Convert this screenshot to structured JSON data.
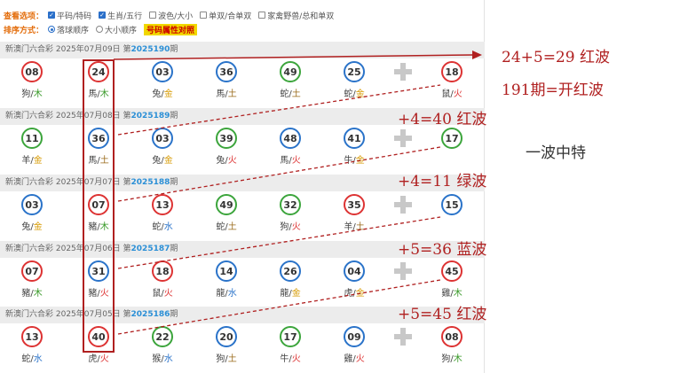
{
  "options": {
    "view_title": "查看选项：",
    "view_items": [
      {
        "label": "平码/特码",
        "checked": true
      },
      {
        "label": "生肖/五行",
        "checked": true
      },
      {
        "label": "波色/大小",
        "checked": false
      },
      {
        "label": "单双/合单双",
        "checked": false
      },
      {
        "label": "家禽野兽/总和单双",
        "checked": false
      }
    ],
    "sort_title": "排序方式：",
    "sort_items": [
      {
        "label": "落球顺序",
        "selected": true
      },
      {
        "label": "大小顺序",
        "selected": false
      }
    ],
    "highlight_label": "号码属性对照"
  },
  "draws": [
    {
      "header": "新澳门六合彩 2025年07月09日 第",
      "issue": "2025190",
      "suffix": "期",
      "balls": [
        {
          "num": "08",
          "color": "red",
          "zodiac": "狗",
          "element": "木",
          "el_class": "el-wood"
        },
        {
          "num": "24",
          "color": "red",
          "zodiac": "馬",
          "element": "木",
          "el_class": "el-wood"
        },
        {
          "num": "03",
          "color": "blue",
          "zodiac": "兔",
          "element": "金",
          "el_class": "el-gold"
        },
        {
          "num": "36",
          "color": "blue",
          "zodiac": "馬",
          "element": "土",
          "el_class": "el-earth"
        },
        {
          "num": "49",
          "color": "green",
          "zodiac": "蛇",
          "element": "土",
          "el_class": "el-earth"
        },
        {
          "num": "25",
          "color": "blue",
          "zodiac": "蛇",
          "element": "金",
          "el_class": "el-gold"
        },
        {
          "num": "18",
          "color": "red",
          "zodiac": "鼠",
          "element": "火",
          "el_class": "el-fire"
        }
      ]
    },
    {
      "header": "新澳门六合彩 2025年07月08日 第",
      "issue": "2025189",
      "suffix": "期",
      "balls": [
        {
          "num": "11",
          "color": "green",
          "zodiac": "羊",
          "element": "金",
          "el_class": "el-gold"
        },
        {
          "num": "36",
          "color": "blue",
          "zodiac": "馬",
          "element": "土",
          "el_class": "el-earth"
        },
        {
          "num": "03",
          "color": "blue",
          "zodiac": "兔",
          "element": "金",
          "el_class": "el-gold"
        },
        {
          "num": "39",
          "color": "green",
          "zodiac": "兔",
          "element": "火",
          "el_class": "el-fire"
        },
        {
          "num": "48",
          "color": "blue",
          "zodiac": "馬",
          "element": "火",
          "el_class": "el-fire"
        },
        {
          "num": "41",
          "color": "blue",
          "zodiac": "牛",
          "element": "金",
          "el_class": "el-gold"
        },
        {
          "num": "17",
          "color": "green",
          "zodiac": "",
          "element": "",
          "el_class": "el-gold"
        }
      ]
    },
    {
      "header": "新澳门六合彩 2025年07月07日 第",
      "issue": "2025188",
      "suffix": "期",
      "balls": [
        {
          "num": "03",
          "color": "blue",
          "zodiac": "兔",
          "element": "金",
          "el_class": "el-gold"
        },
        {
          "num": "07",
          "color": "red",
          "zodiac": "豬",
          "element": "木",
          "el_class": "el-wood"
        },
        {
          "num": "13",
          "color": "red",
          "zodiac": "蛇",
          "element": "水",
          "el_class": "el-water"
        },
        {
          "num": "49",
          "color": "green",
          "zodiac": "蛇",
          "element": "土",
          "el_class": "el-earth"
        },
        {
          "num": "32",
          "color": "green",
          "zodiac": "狗",
          "element": "火",
          "el_class": "el-fire"
        },
        {
          "num": "35",
          "color": "red",
          "zodiac": "羊",
          "element": "土",
          "el_class": "el-earth"
        },
        {
          "num": "15",
          "color": "blue",
          "zodiac": "",
          "element": "",
          "el_class": "el-gold"
        }
      ]
    },
    {
      "header": "新澳门六合彩 2025年07月06日 第",
      "issue": "2025187",
      "suffix": "期",
      "balls": [
        {
          "num": "07",
          "color": "red",
          "zodiac": "豬",
          "element": "木",
          "el_class": "el-wood"
        },
        {
          "num": "31",
          "color": "blue",
          "zodiac": "豬",
          "element": "火",
          "el_class": "el-fire"
        },
        {
          "num": "18",
          "color": "red",
          "zodiac": "鼠",
          "element": "火",
          "el_class": "el-fire"
        },
        {
          "num": "14",
          "color": "blue",
          "zodiac": "龍",
          "element": "水",
          "el_class": "el-water"
        },
        {
          "num": "26",
          "color": "blue",
          "zodiac": "龍",
          "element": "金",
          "el_class": "el-gold"
        },
        {
          "num": "04",
          "color": "blue",
          "zodiac": "虎",
          "element": "金",
          "el_class": "el-gold"
        },
        {
          "num": "45",
          "color": "red",
          "zodiac": "雞",
          "element": "木",
          "el_class": "el-wood"
        }
      ]
    },
    {
      "header": "新澳门六合彩 2025年07月05日 第",
      "issue": "2025186",
      "suffix": "期",
      "balls": [
        {
          "num": "13",
          "color": "red",
          "zodiac": "蛇",
          "element": "水",
          "el_class": "el-water"
        },
        {
          "num": "40",
          "color": "red",
          "zodiac": "虎",
          "element": "火",
          "el_class": "el-fire"
        },
        {
          "num": "22",
          "color": "green",
          "zodiac": "猴",
          "element": "水",
          "el_class": "el-water"
        },
        {
          "num": "20",
          "color": "blue",
          "zodiac": "狗",
          "element": "土",
          "el_class": "el-earth"
        },
        {
          "num": "17",
          "color": "green",
          "zodiac": "牛",
          "element": "火",
          "el_class": "el-fire"
        },
        {
          "num": "09",
          "color": "blue",
          "zodiac": "雞",
          "element": "火",
          "el_class": "el-fire"
        },
        {
          "num": "08",
          "color": "red",
          "zodiac": "狗",
          "element": "木",
          "el_class": "el-wood"
        }
      ]
    }
  ],
  "annotations": {
    "line1": "24+5=29 红波",
    "line2": "191期=开红波",
    "line3": "一波中特",
    "step1": "+4=40 红波",
    "step2": "+4=11 绿波",
    "step3": "+5=36 蓝波",
    "step4": "+5=45 红波"
  },
  "colors": {
    "red": "#d33333",
    "blue": "#2a73c9",
    "green": "#3ca53c",
    "annotation": "#b02020"
  }
}
